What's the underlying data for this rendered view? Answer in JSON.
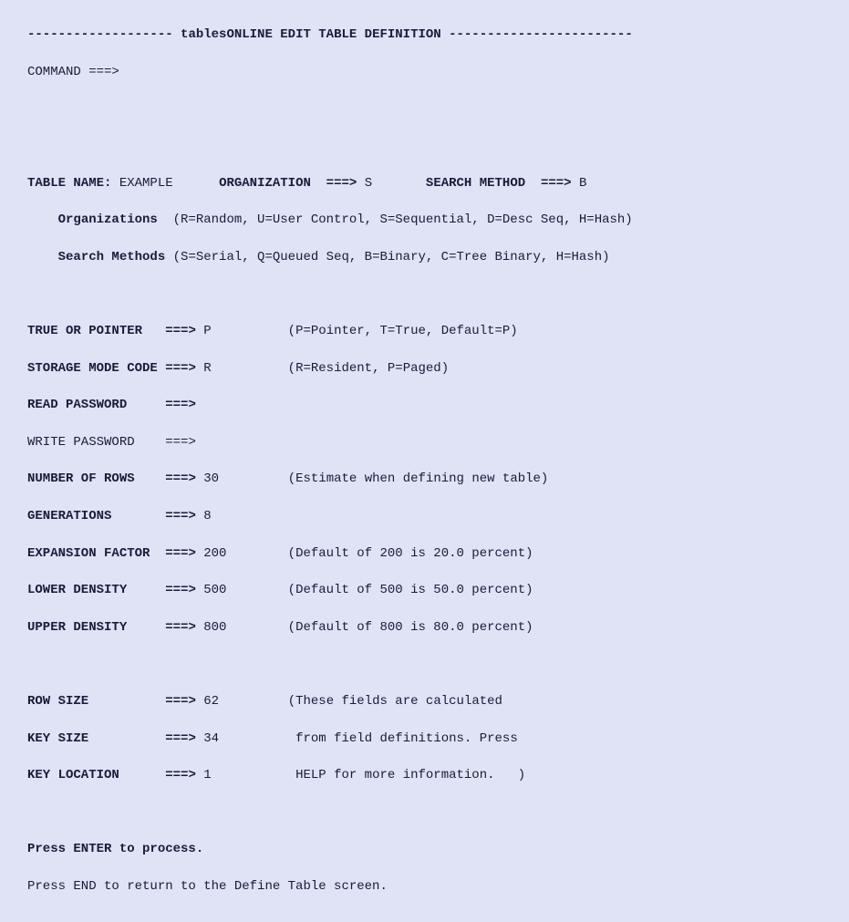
{
  "title": {
    "dash_left": "-------------------",
    "label": " tablesONLINE EDIT TABLE DEFINITION ",
    "dash_right": "------------------------"
  },
  "command": {
    "label": "COMMAND ===>",
    "value": ""
  },
  "header": {
    "table_name_label": "TABLE NAME:",
    "table_name_value": " EXAMPLE",
    "org_label": "ORGANIZATION  ===>",
    "org_value": " S",
    "search_label": "SEARCH METHOD  ===>",
    "search_value": " B"
  },
  "legends": {
    "org_label": "Organizations",
    "org_text": "  (R=Random, U=User Control, S=Sequential, D=Desc Seq, H=Hash)",
    "search_label": "Search Methods",
    "search_text": " (S=Serial, Q=Queued Seq, B=Binary, C=Tree Binary, H=Hash)"
  },
  "fields": {
    "true_pointer": {
      "label": "TRUE OR POINTER   ",
      "arrow": "===>",
      "value": " P",
      "hint": "(P=Pointer, T=True, Default=P)"
    },
    "storage_mode": {
      "label": "STORAGE MODE CODE ",
      "arrow": "===>",
      "value": " R",
      "hint": "(R=Resident, P=Paged)"
    },
    "read_pw": {
      "label": "READ PASSWORD     ",
      "arrow": "===>",
      "value": "",
      "hint": ""
    },
    "write_pw": {
      "label": "WRITE PASSWORD    ",
      "arrow": "===>",
      "value": "",
      "hint": ""
    },
    "num_rows": {
      "label": "NUMBER OF ROWS    ",
      "arrow": "===>",
      "value": " 30",
      "hint": "(Estimate when defining new table)"
    },
    "generations": {
      "label": "GENERATIONS       ",
      "arrow": "===>",
      "value": " 8",
      "hint": ""
    },
    "expansion": {
      "label": "EXPANSION FACTOR  ",
      "arrow": "===>",
      "value": " 200",
      "hint": "(Default of 200 is 20.0 percent)"
    },
    "lower_density": {
      "label": "LOWER DENSITY     ",
      "arrow": "===>",
      "value": " 500",
      "hint": "(Default of 500 is 50.0 percent)"
    },
    "upper_density": {
      "label": "UPPER DENSITY     ",
      "arrow": "===>",
      "value": " 800",
      "hint": "(Default of 800 is 80.0 percent)"
    },
    "row_size": {
      "label": "ROW SIZE          ",
      "arrow": "===>",
      "value": " 62",
      "hint": "(These fields are calculated"
    },
    "key_size": {
      "label": "KEY SIZE          ",
      "arrow": "===>",
      "value": " 34",
      "hint": " from field definitions. Press"
    },
    "key_location": {
      "label": "KEY LOCATION      ",
      "arrow": "===>",
      "value": " 1",
      "hint": " HELP for more information.   )"
    }
  },
  "footer": {
    "enter": "Press ENTER to process.",
    "end": "Press END to return to the Define Table screen."
  },
  "spacing": {
    "gap6": "      ",
    "gap7": "       ",
    "gap10": "          ",
    "gap4": "    ",
    "val_hint_pad": "        "
  }
}
